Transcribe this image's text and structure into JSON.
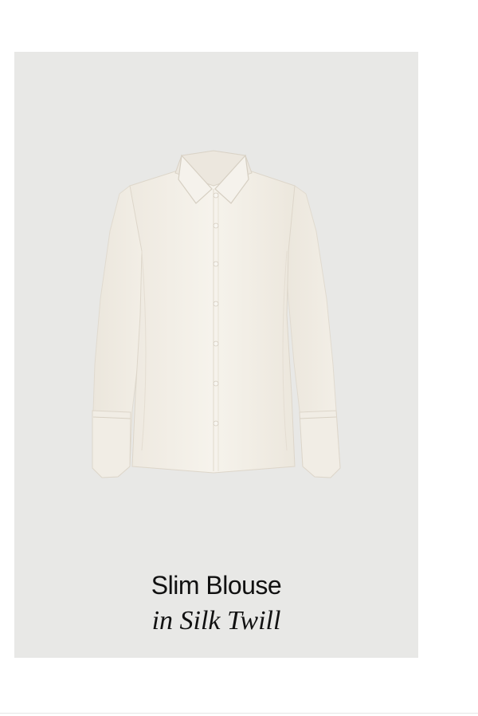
{
  "product": {
    "title": "Slim Blouse",
    "subtitle": "in Silk Twill",
    "image_icon": "white-silk-blouse",
    "colors": {
      "card_background": "#e8e8e6",
      "garment": "#f4f1ea",
      "text": "#111111"
    }
  }
}
